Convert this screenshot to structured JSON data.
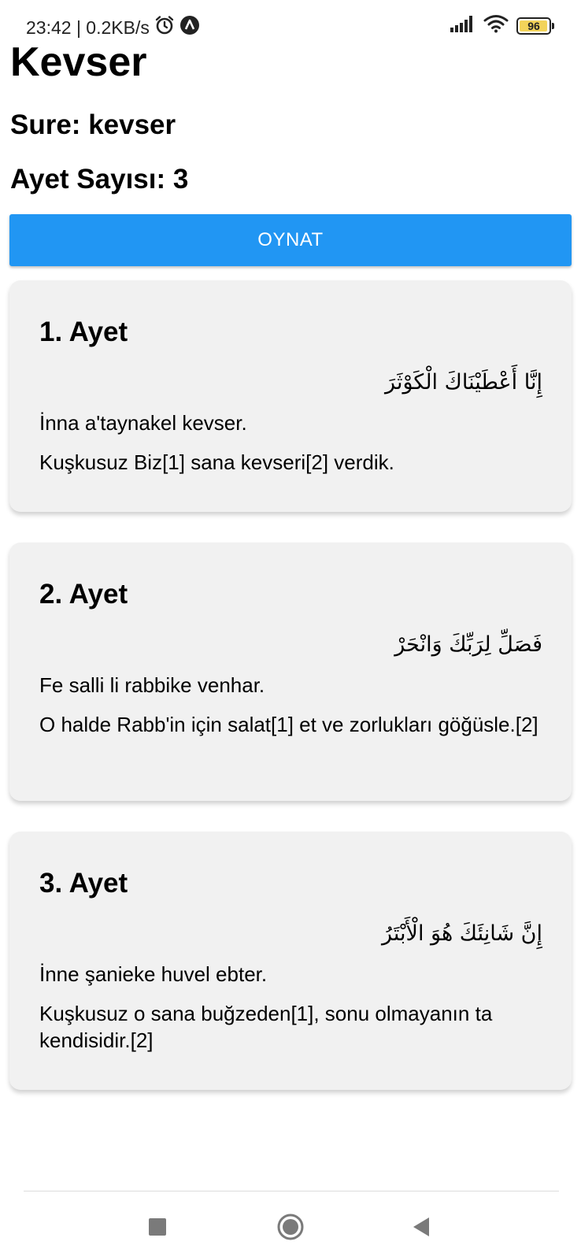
{
  "status_bar": {
    "time_speed": "23:42 | 0.2KB/s",
    "battery": "96",
    "battery_level_fraction": 0.96,
    "icons": [
      "alarm-icon",
      "app-notification-icon",
      "signal-icon",
      "wifi-icon",
      "battery-icon"
    ]
  },
  "header": {
    "title": "Kevser",
    "sure_line": "Sure: kevser",
    "count_line": "Ayet Sayısı: 3"
  },
  "play_button": {
    "label": "OYNAT",
    "color": "#2196f3"
  },
  "ayets": [
    {
      "title": "1. Ayet",
      "arabic": "إِنَّا أَعْطَيْنَاكَ الْكَوْثَرَ",
      "transliteration": "İnna a'taynakel kevser.",
      "meaning": "Kuşkusuz Biz[1] sana kevseri[2] verdik."
    },
    {
      "title": "2. Ayet",
      "arabic": "فَصَلِّ لِرَبِّكَ وَانْحَرْ",
      "transliteration": "Fe salli li rabbike venhar.",
      "meaning": "O halde Rabb'in için salat[1] et ve zorlukları göğüsle.[2]"
    },
    {
      "title": "3. Ayet",
      "arabic": "إِنَّ شَانِئَكَ هُوَ الْأَبْتَرُ",
      "transliteration": "İnne şanieke huvel ebter.",
      "meaning": "Kuşkusuz o sana buğzeden[1],  sonu olmayanın ta kendisidir.[2]"
    }
  ],
  "nav_bar": {
    "icons": [
      "recents-square-icon",
      "home-circle-icon",
      "back-triangle-icon"
    ]
  }
}
